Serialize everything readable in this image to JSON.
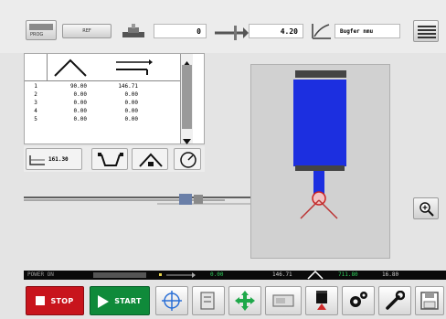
{
  "toolbar": {
    "mode_label": "PROG",
    "small_btn_label": "REF",
    "count_value": "0",
    "length_value": "4.20",
    "material_label": "Bugfer nmu"
  },
  "table": {
    "rows": [
      {
        "idx": "1",
        "angle": "90.00",
        "length": "146.71"
      },
      {
        "idx": "2",
        "angle": "0.00",
        "length": "0.00"
      },
      {
        "idx": "3",
        "angle": "0.00",
        "length": "0.00"
      },
      {
        "idx": "4",
        "angle": "0.00",
        "length": "0.00"
      },
      {
        "idx": "5",
        "angle": "0.00",
        "length": "0.00"
      }
    ]
  },
  "tool_row": {
    "flat_value": "161.30"
  },
  "status_bar": {
    "power_label": "POWER ON",
    "value_1": "0.00",
    "value_2": "146.71",
    "value_3": "711.80",
    "value_4": "16.80"
  },
  "buttons": {
    "stop_label": "STOP",
    "start_label": "START"
  },
  "colors": {
    "stop": "#c8141c",
    "start": "#0f8a3a",
    "beam": "#1c2fe0",
    "status_bg": "#0a0a0a"
  }
}
